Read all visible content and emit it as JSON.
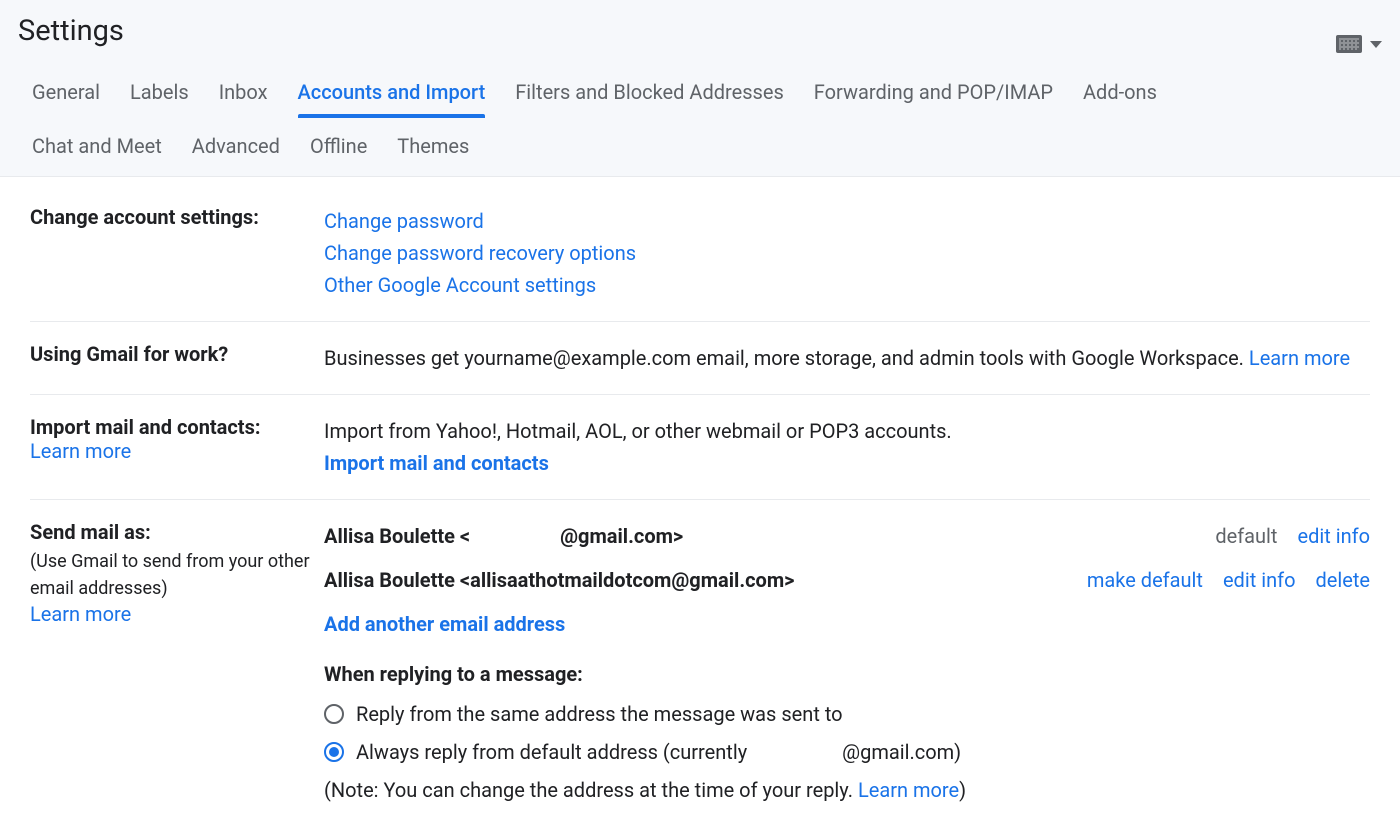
{
  "header": {
    "title": "Settings"
  },
  "tabs": {
    "row1": [
      "General",
      "Labels",
      "Inbox",
      "Accounts and Import",
      "Filters and Blocked Addresses",
      "Forwarding and POP/IMAP",
      "Add-ons"
    ],
    "row2": [
      "Chat and Meet",
      "Advanced",
      "Offline",
      "Themes"
    ],
    "active_index": 3
  },
  "sections": {
    "change_account": {
      "label": "Change account settings:",
      "links": {
        "change_password": "Change password",
        "recovery": "Change password recovery options",
        "other": "Other Google Account settings"
      }
    },
    "work": {
      "label": "Using Gmail for work?",
      "text_prefix": "Businesses get yourname@example.com email, more storage, and admin tools with Google Workspace. ",
      "learn_more": "Learn more"
    },
    "import": {
      "label": "Import mail and contacts:",
      "learn_more": "Learn more",
      "text": "Import from Yahoo!, Hotmail, AOL, or other webmail or POP3 accounts.",
      "action": "Import mail and contacts"
    },
    "send_as": {
      "label": "Send mail as:",
      "sub": "(Use Gmail to send from your other email addresses)",
      "learn_more": "Learn more",
      "rows": [
        {
          "name_prefix": "Allisa Boulette <",
          "email_suffix": "@gmail.com>",
          "redacted": true,
          "default_label": "default",
          "edit": "edit info"
        },
        {
          "full": "Allisa Boulette <allisaathotmaildotcom@gmail.com>",
          "make_default": "make default",
          "edit": "edit info",
          "delete": "delete"
        }
      ],
      "add_another": "Add another email address",
      "reply_heading": "When replying to a message:",
      "option1": "Reply from the same address the message was sent to",
      "option2_prefix": "Always reply from default address (currently ",
      "option2_suffix": "@gmail.com)",
      "note_prefix": "(Note: You can change the address at the time of your reply. ",
      "note_link": "Learn more",
      "note_suffix": ")"
    }
  }
}
